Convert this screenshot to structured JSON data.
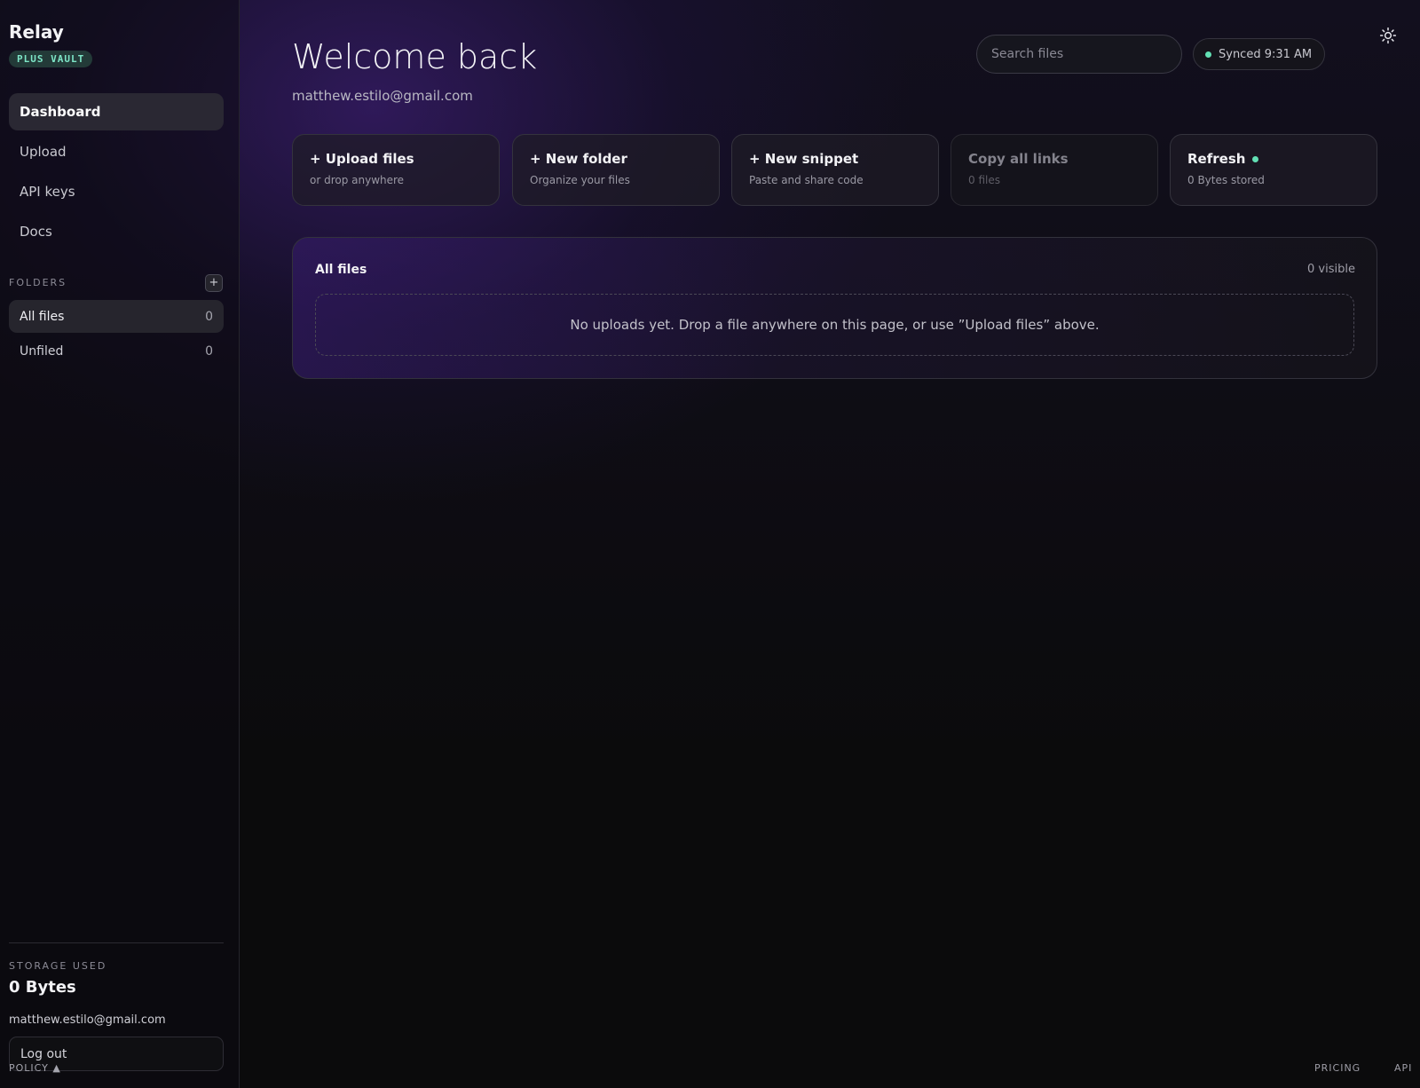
{
  "sidebar": {
    "brand": "Relay",
    "plan_badge": "PLUS VAULT",
    "nav": [
      {
        "label": "Dashboard",
        "active": true
      },
      {
        "label": "Upload"
      },
      {
        "label": "API keys"
      },
      {
        "label": "Docs"
      }
    ],
    "folders_label": "FOLDERS",
    "add_folder_icon": "+",
    "folders": [
      {
        "label": "All files",
        "count": "0",
        "active": true
      },
      {
        "label": "Unfiled",
        "count": "0"
      }
    ],
    "storage_label": "STORAGE USED",
    "storage_value": "0 Bytes",
    "email": "matthew.estilo@gmail.com",
    "logout_label": "Log out",
    "policy_label": "POLICY ▲"
  },
  "header": {
    "title": "Welcome back",
    "email": "matthew.estilo@gmail.com",
    "search_placeholder": "Search files",
    "sync_text": "Synced 9:31 AM",
    "theme_icon": "sun-icon"
  },
  "actions": [
    {
      "title": "+ Upload files",
      "sub": "or drop anywhere"
    },
    {
      "title": "+ New folder",
      "sub": "Organize your files"
    },
    {
      "title": "+ New snippet",
      "sub": "Paste and share code"
    },
    {
      "title": "Copy all links",
      "sub": "0 files",
      "disabled": true
    },
    {
      "title": "Refresh",
      "sub": "0 Bytes stored",
      "status_dot": true
    }
  ],
  "files": {
    "title": "All files",
    "count": "0 visible",
    "empty_message": "No uploads yet. Drop a file anywhere on this page, or use ”Upload files” above."
  },
  "footer": {
    "pricing": "PRICING",
    "api": "API"
  },
  "colors": {
    "accent_green": "#62e0b4",
    "badge_bg": "#233a38",
    "badge_text": "#7ee6c8",
    "glow_purple": "#48228c"
  }
}
